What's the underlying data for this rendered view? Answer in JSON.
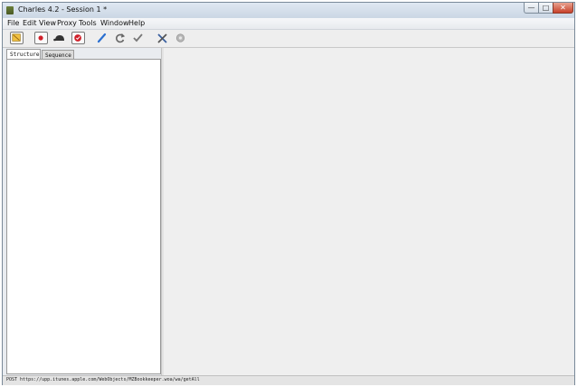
{
  "window": {
    "title": "Charles 4.2 - Session 1 *",
    "controls": {
      "minimize": "—",
      "maximize": "□",
      "close": "✕"
    }
  },
  "menubar": {
    "items": [
      "File",
      "Edit",
      "View",
      "Proxy",
      "Tools",
      "Window",
      "Help"
    ]
  },
  "toolbar": {
    "buttons": [
      {
        "icon": "broom-icon"
      },
      {
        "icon": "record-icon"
      },
      {
        "icon": "turtle-throttle-icon"
      },
      {
        "icon": "breakpoint-stop-icon"
      },
      {
        "icon": "compose-pen-icon"
      },
      {
        "icon": "repeat-icon"
      },
      {
        "icon": "validate-check-icon"
      },
      {
        "icon": "tools-icon"
      },
      {
        "icon": "settings-gear-icon"
      }
    ]
  },
  "left_panel": {
    "tabs": [
      "Structure",
      "Sequence"
    ],
    "selected_tab": "Structure"
  },
  "statusbar": {
    "text": "POST https://upp.itunes.apple.com/WebObjects/MZBookkeeper.woa/wa/getAll"
  },
  "colors": {
    "record": "#d0202a",
    "breakpoint": "#d0202a",
    "compose": "#2a6fd0",
    "tools": "#3a5f9f"
  }
}
